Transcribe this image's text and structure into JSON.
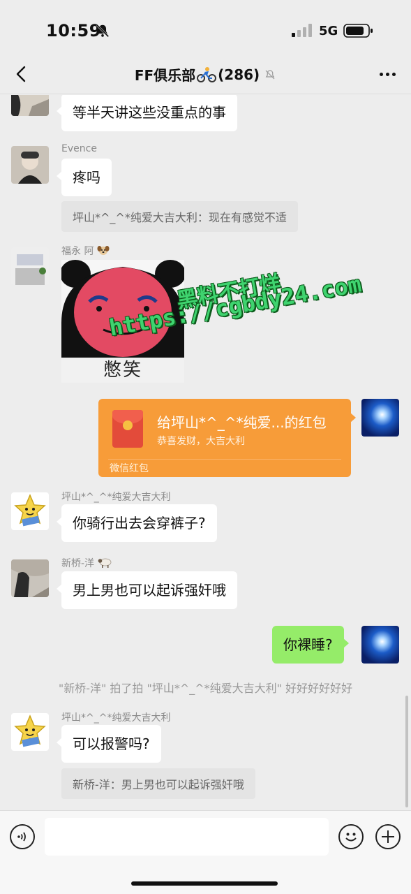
{
  "status_bar": {
    "time": "10:59",
    "network": "5G"
  },
  "nav": {
    "title": "FF俱乐部",
    "count": "(286)"
  },
  "messages": [
    {
      "text": "等半天讲这些没重点的事"
    },
    {
      "sender": "Evence",
      "text": "疼吗",
      "quote": "坪山*^_^*纯爱大吉大利：现在有感觉不适"
    },
    {
      "sender": "福永 阿",
      "sticker_caption": "憋笑"
    },
    {
      "redpacket_title": "给坪山*^_^*纯爱...的红包",
      "redpacket_sub": "恭喜发财，大吉大利",
      "redpacket_footer": "微信红包"
    },
    {
      "sender": "坪山*^_^*纯爱大吉大利",
      "text": "你骑行出去会穿裤子?"
    },
    {
      "sender": "新桥-洋",
      "text": "男上男也可以起诉强奸哦"
    },
    {
      "text": "你裸睡?"
    },
    {
      "system": "\"新桥-洋\" 拍了拍 \"坪山*^_^*纯爱大吉大利\" 好好好好好好"
    },
    {
      "sender": "坪山*^_^*纯爱大吉大利",
      "text": "可以报警吗?",
      "quote": "新桥-洋：男上男也可以起诉强奸哦"
    }
  ],
  "watermark": {
    "line1": "黑料不打烊",
    "line2": "https://cgbdy24.com"
  },
  "colors": {
    "background": "#ededed",
    "self_bubble": "#95ec69",
    "redpacket": "#f79c39",
    "watermark": "#3fd36f"
  }
}
